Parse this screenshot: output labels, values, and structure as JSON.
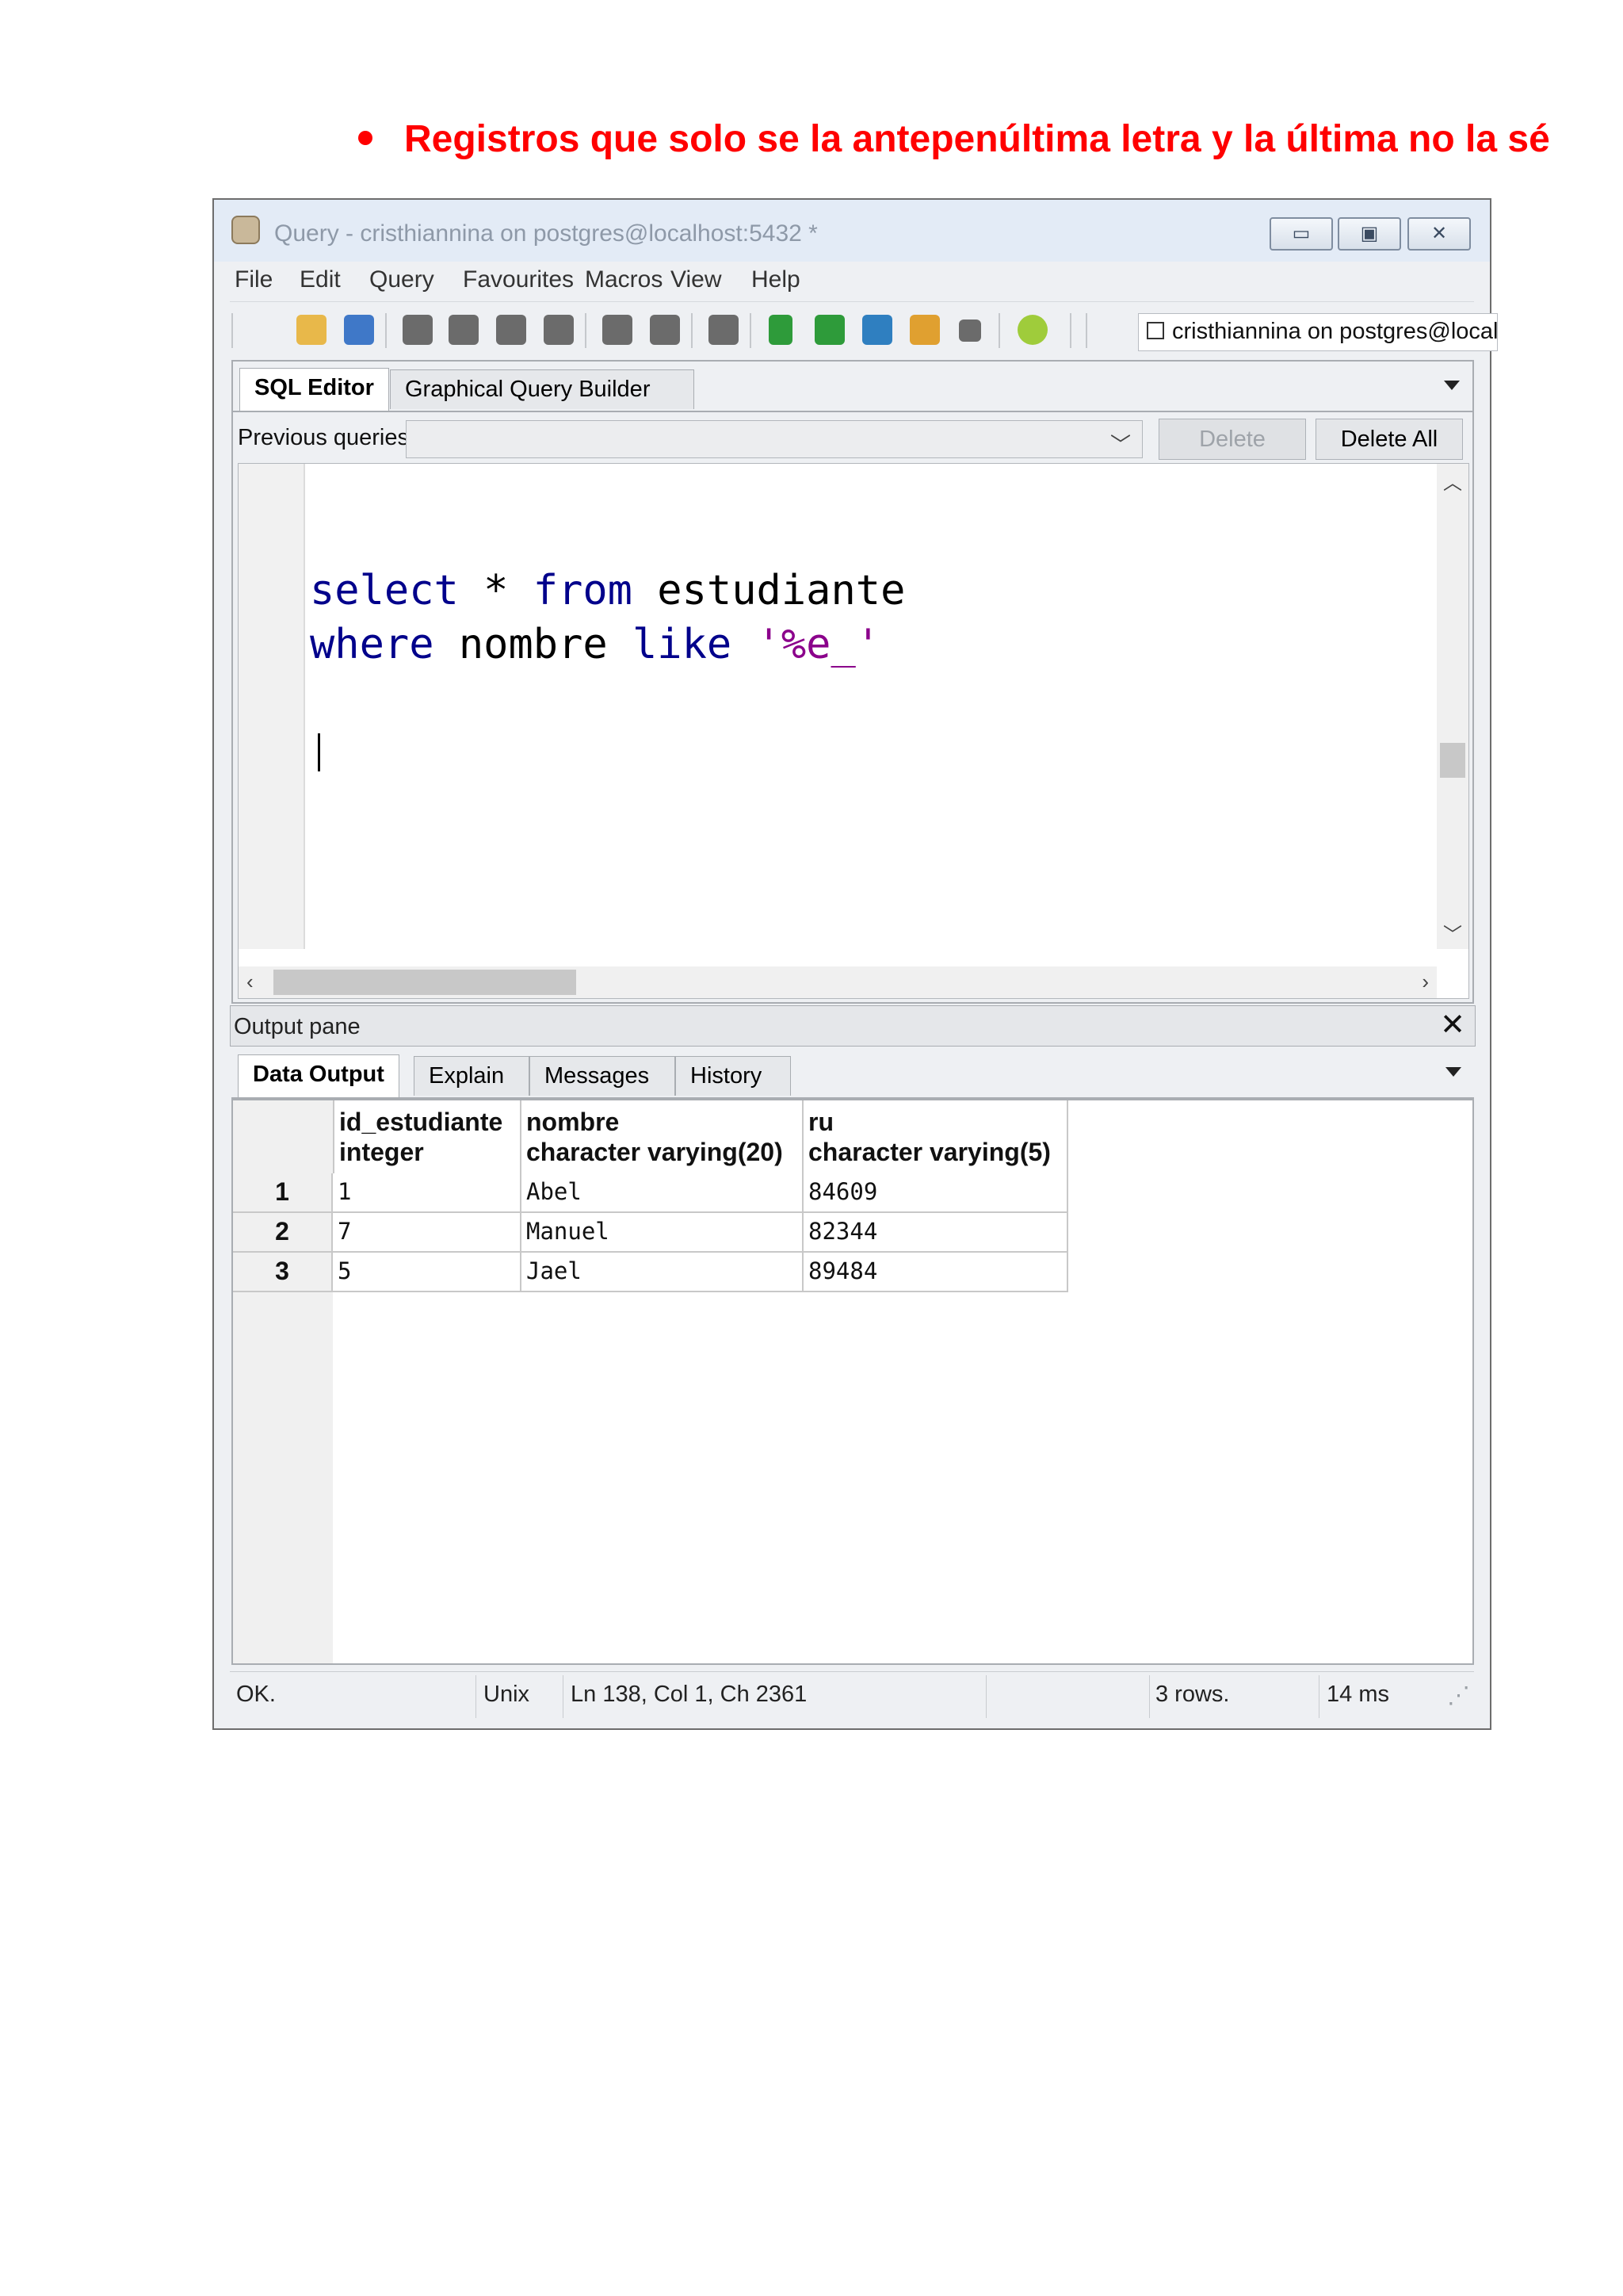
{
  "document": {
    "heading": "Registros que solo se la antepenúltima  letra y la última  no la sé"
  },
  "window": {
    "title": "Query - cristhiannina on postgres@localhost:5432 *",
    "controls": [
      "minimize",
      "maximize",
      "close"
    ]
  },
  "menu": {
    "items": [
      "File",
      "Edit",
      "Query",
      "Favourites",
      "Macros",
      "View",
      "Help"
    ]
  },
  "toolbar": {
    "icons": [
      "open-file-icon",
      "save-icon",
      "cut-icon",
      "copy-icon",
      "paste-icon",
      "clear-icon",
      "undo-icon",
      "redo-icon",
      "find-icon",
      "execute-icon",
      "explain-icon",
      "execute-to-file-icon",
      "explain-analyze-icon",
      "stop-icon",
      "help-icon"
    ],
    "connection": "cristhiannina on postgres@localh"
  },
  "editor": {
    "tabs": [
      "SQL Editor",
      "Graphical Query Builder"
    ],
    "active_tab": "SQL Editor",
    "previous_queries_label": "Previous queries",
    "previous_queries_value": "",
    "delete_label": "Delete",
    "delete_all_label": "Delete All",
    "code": {
      "line1_kw1": "select",
      "line1_star": " * ",
      "line1_kw2": "from",
      "line1_rest": " estudiante",
      "line2_kw1": "where",
      "line2_mid": " nombre ",
      "line2_kw2": "like",
      "line2_sp": " ",
      "line2_str": "'%e_'"
    }
  },
  "output": {
    "title": "Output pane",
    "tabs": [
      "Data Output",
      "Explain",
      "Messages",
      "History"
    ],
    "active_tab": "Data Output",
    "columns": [
      {
        "name": "id_estudiante",
        "type": "integer"
      },
      {
        "name": "nombre",
        "type": "character varying(20)"
      },
      {
        "name": "ru",
        "type": "character varying(5)"
      }
    ],
    "rows": [
      {
        "n": "1",
        "id": "1",
        "nombre": "Abel",
        "ru": "84609"
      },
      {
        "n": "2",
        "id": "7",
        "nombre": "Manuel",
        "ru": "82344"
      },
      {
        "n": "3",
        "id": "5",
        "nombre": "Jael",
        "ru": "89484"
      }
    ]
  },
  "status": {
    "state": "OK.",
    "line_endings": "Unix",
    "position": "Ln 138, Col 1, Ch 2361",
    "rows": "3 rows.",
    "time": "14 ms"
  },
  "colors": {
    "heading": "#ff0000",
    "keyword": "#00008b",
    "string": "#8b008b"
  }
}
